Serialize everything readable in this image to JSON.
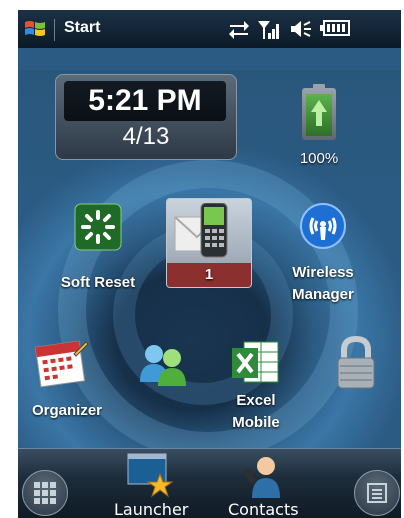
{
  "status_bar": {
    "start_label": "Start",
    "icons": [
      "windows-logo-icon",
      "data-connection-icon",
      "signal-strength-icon",
      "speaker-icon",
      "battery-status-icon"
    ]
  },
  "clock": {
    "time": "5:21 PM",
    "date": "4/13"
  },
  "battery": {
    "percent_label": "100%",
    "level": 1.0
  },
  "home_items": [
    {
      "name": "soft-reset",
      "label": "Soft Reset",
      "icon": "soft-reset-icon"
    },
    {
      "name": "messages",
      "label": "1",
      "icon": "phone-envelope-icon"
    },
    {
      "name": "wireless-manager",
      "label_line1": "Wireless",
      "label_line2": "Manager",
      "icon": "wireless-icon"
    },
    {
      "name": "organizer",
      "label": "Organizer",
      "icon": "calendar-icon"
    },
    {
      "name": "contacts-people",
      "label": "",
      "icon": "people-icon"
    },
    {
      "name": "excel-mobile",
      "label_line1": "Excel",
      "label_line2": "Mobile",
      "icon": "excel-icon"
    },
    {
      "name": "lock",
      "label": "",
      "icon": "padlock-icon"
    }
  ],
  "bottom_bar": {
    "launcher_label": "Launcher",
    "contacts_label": "Contacts"
  },
  "colors": {
    "badge_red": "#8c2f2f",
    "excel_green": "#2e8b3a",
    "wireless_blue": "#1e6fd4"
  }
}
